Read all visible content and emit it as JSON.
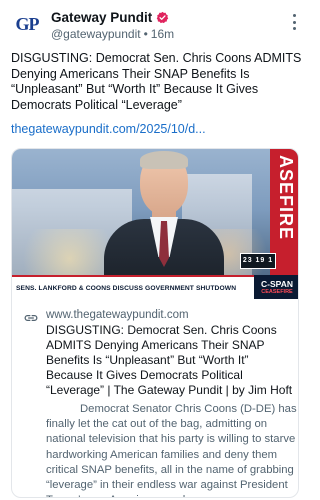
{
  "author": {
    "avatar_text": "GP",
    "name": "Gateway Pundit",
    "handle": "@gatewaypundit",
    "separator": "•",
    "time": "16m"
  },
  "post": {
    "text": "DISGUSTING: Democrat Sen. Chris Coons ADMITS Denying Americans Their SNAP Benefits Is “Unpleasant” But “Worth It” Because It Gives Democrats Political “Leverage”",
    "link": "thegatewaypundit.com/2025/10/d..."
  },
  "card": {
    "media": {
      "backdrop_text": "ASEFIRE",
      "countdown": "23 19 1",
      "chyron": "SENS. LANKFORD & COONS DISCUSS GOVERNMENT SHUTDOWN",
      "network": "C-SPAN",
      "network_sub": "CEASEFIRE"
    },
    "domain": "www.thegatewaypundit.com",
    "title": "DISGUSTING: Democrat Sen. Chris Coons ADMITS Denying Americans Their SNAP Benefits Is “Unpleasant” But “Worth It” Because It Gives Democrats Political “Leverage” | The Gateway Pundit | by Jim Hoft",
    "description": "Democrat Senator Chris Coons (D-DE) has finally let the cat out of the bag, admitting on national television that his party is willing to starve hardworking American families and deny them critical SNAP benefits, all in the name of grabbing “leverage” in their endless war against President Trump's pro-America agenda."
  },
  "colors": {
    "link": "#1a6ec9",
    "verified_badge": "#e0245e",
    "avatar": "#1b3f8f",
    "muted_text": "#536471"
  },
  "icons": {
    "verified": "verified-badge-icon",
    "more": "more-vertical-icon",
    "link": "link-icon"
  }
}
